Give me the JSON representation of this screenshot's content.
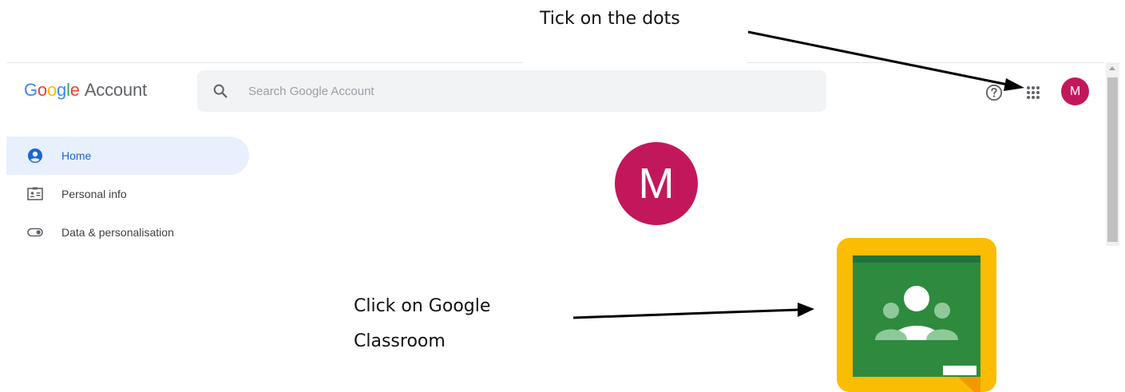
{
  "annotations": {
    "dots": "Tick on the dots",
    "classroom_line1": "Click on Google",
    "classroom_line2": "Classroom"
  },
  "header": {
    "logo_letters": [
      "G",
      "o",
      "o",
      "g",
      "l",
      "e"
    ],
    "logo_suffix": "Account",
    "search_placeholder": "Search Google Account",
    "avatar_letter": "M",
    "icons": [
      "search-icon",
      "help-icon",
      "apps-grid-icon"
    ]
  },
  "sidebar": {
    "items": [
      {
        "label": "Home",
        "icon": "account-circle-icon",
        "active": true
      },
      {
        "label": "Personal info",
        "icon": "id-card-icon",
        "active": false
      },
      {
        "label": "Data & personalisation",
        "icon": "toggle-icon",
        "active": false
      }
    ]
  },
  "profile": {
    "avatar_letter": "M"
  },
  "colors": {
    "avatar": "#c2185b",
    "active_nav_bg": "#e8f0fe",
    "active_nav_text": "#1967d2",
    "search_bg": "#f1f3f4",
    "classroom_yellow": "#fbbc04",
    "classroom_green": "#34a853"
  }
}
